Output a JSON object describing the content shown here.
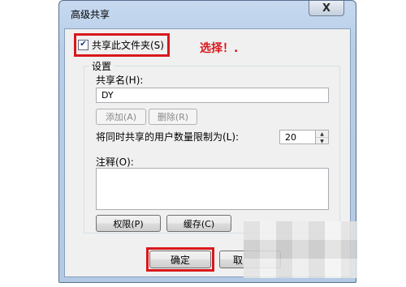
{
  "window": {
    "title": "高级共享",
    "close_symbol": "X"
  },
  "share_checkbox": {
    "label": "共享此文件夹(S)",
    "checked": true,
    "check_symbol": "✔"
  },
  "annotation": "选择！.",
  "settings": {
    "group_title": "设置",
    "share_name_label": "共享名(H):",
    "share_name_value": "DY",
    "add_button": "添加(A)",
    "remove_button": "删除(R)",
    "user_limit_label": "将同时共享的用户数量限制为(L):",
    "user_limit_value": "20",
    "comment_label": "注释(O):",
    "comment_value": "",
    "permissions_button": "权限(P)",
    "caching_button": "缓存(C)"
  },
  "footer": {
    "ok_button": "确定",
    "cancel_button": "取"
  },
  "colors": {
    "highlight": "#d9181c"
  }
}
